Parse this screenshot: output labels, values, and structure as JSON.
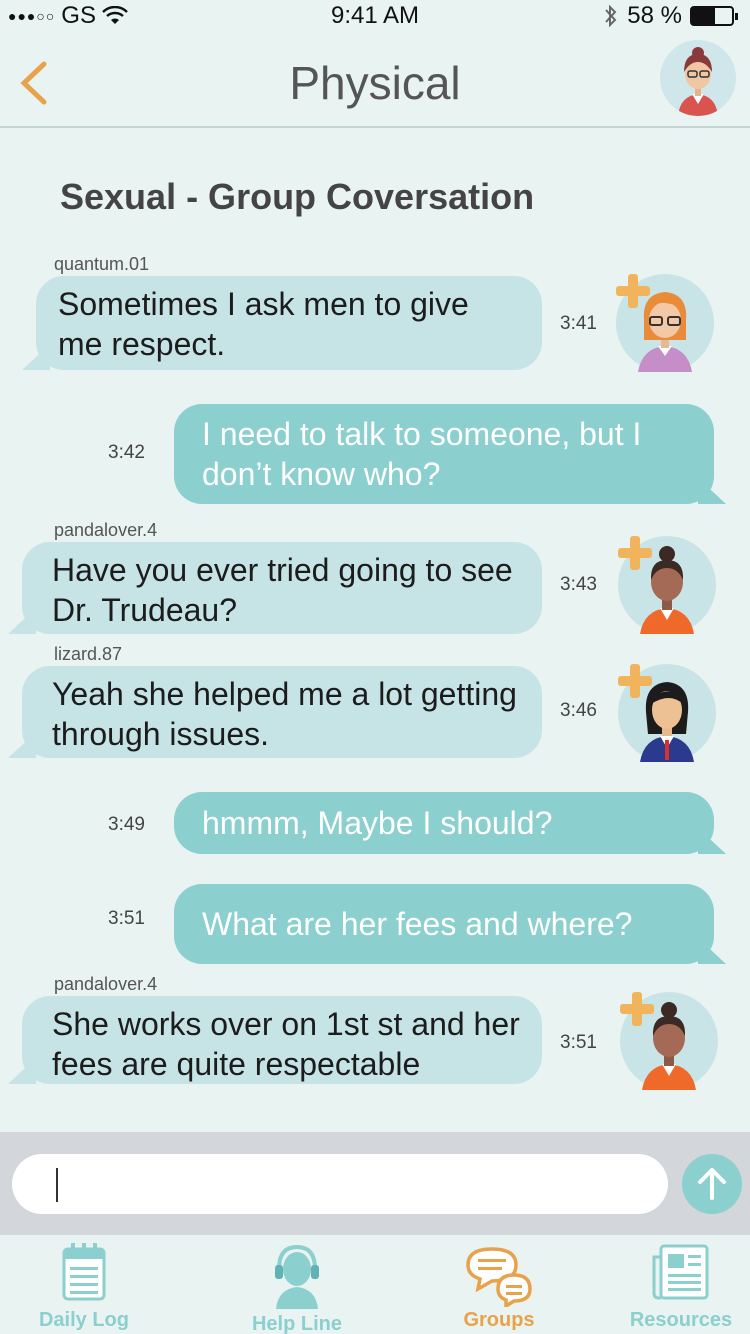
{
  "status_bar": {
    "carrier": "GS",
    "time": "9:41 AM",
    "battery": "58 %",
    "battery_level": 0.58
  },
  "header": {
    "title": "Physical"
  },
  "conversation": {
    "title": "Sexual - Group Coversation",
    "messages": [
      {
        "sender": "quantum.01",
        "text": "Sometimes I ask men to give me respect.",
        "time": "3:41",
        "direction": "incoming"
      },
      {
        "text": "I need to talk to someone, but I don’t know who?",
        "time": "3:42",
        "direction": "outgoing"
      },
      {
        "sender": "pandalover.4",
        "text": "Have you ever tried going to see Dr. Trudeau?",
        "time": "3:43",
        "direction": "incoming"
      },
      {
        "sender": "lizard.87",
        "text": "Yeah she helped me a lot getting through issues.",
        "time": "3:46",
        "direction": "incoming"
      },
      {
        "text": "hmmm, Maybe I should?",
        "time": "3:49",
        "direction": "outgoing"
      },
      {
        "text": "What are her fees and where?",
        "time": "3:51",
        "direction": "outgoing"
      },
      {
        "sender": "pandalover.4",
        "text": "She works over on 1st st and her fees are quite respectable",
        "time": "3:51",
        "direction": "incoming"
      }
    ]
  },
  "composer": {
    "value": "",
    "send_icon": "arrow-up-icon"
  },
  "tabs": [
    {
      "label": "Daily Log",
      "icon": "calendar-icon",
      "active": false
    },
    {
      "label": "Help Line",
      "icon": "headset-icon",
      "active": false
    },
    {
      "label": "Groups",
      "icon": "chat-bubbles-icon",
      "active": true
    },
    {
      "label": "Resources",
      "icon": "newspaper-icon",
      "active": false
    }
  ],
  "colors": {
    "accent": "#e8a24a",
    "teal": "#8bcfce",
    "bubble_in": "#c6e4e6",
    "background": "#e8f3f2"
  }
}
